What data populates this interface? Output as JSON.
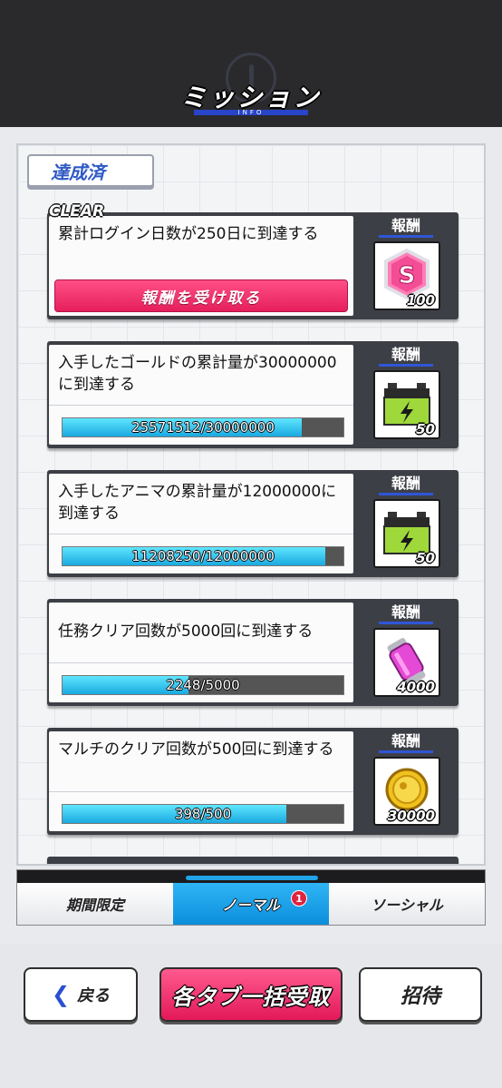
{
  "header": {
    "title": "ミッション",
    "subtitle": "INFO"
  },
  "section_tag": "達成済",
  "clear_label": "CLEAR",
  "reward_header": "報酬",
  "missions": [
    {
      "text": "累計ログイン日数が250日に到達する",
      "claim_label": "報酬を受け取る",
      "reward_icon": "s-gem-icon",
      "reward_qty": "100",
      "cleared": true
    },
    {
      "text": "入手したゴールドの累計量が30000000に到達する",
      "progress_text": "25571512/30000000",
      "progress": 0.852,
      "reward_icon": "battery-icon",
      "reward_qty": "50"
    },
    {
      "text": "入手したアニマの累計量が12000000に到達する",
      "progress_text": "11208250/12000000",
      "progress": 0.934,
      "reward_icon": "battery-icon",
      "reward_qty": "50"
    },
    {
      "text": "任務クリア回数が5000回に到達する",
      "progress_text": "2248/5000",
      "progress": 0.4496,
      "reward_icon": "pink-capsule-icon",
      "reward_qty": "4000"
    },
    {
      "text": "マルチのクリア回数が500回に到達する",
      "progress_text": "398/500",
      "progress": 0.796,
      "reward_icon": "gold-coin-icon",
      "reward_qty": "30000"
    }
  ],
  "tabs": [
    {
      "label": "期間限定",
      "active": false
    },
    {
      "label": "ノーマル",
      "active": true,
      "badge": "1"
    },
    {
      "label": "ソーシャル",
      "active": false
    }
  ],
  "buttons": {
    "back": "戻る",
    "claim_all": "各タブ一括受取",
    "invite": "招待"
  },
  "colors": {
    "accent_pink": "#e51f5b",
    "accent_blue": "#0c8fdc",
    "progress_cyan": "#1aa9e0",
    "header_bg": "#2a2a2c"
  }
}
